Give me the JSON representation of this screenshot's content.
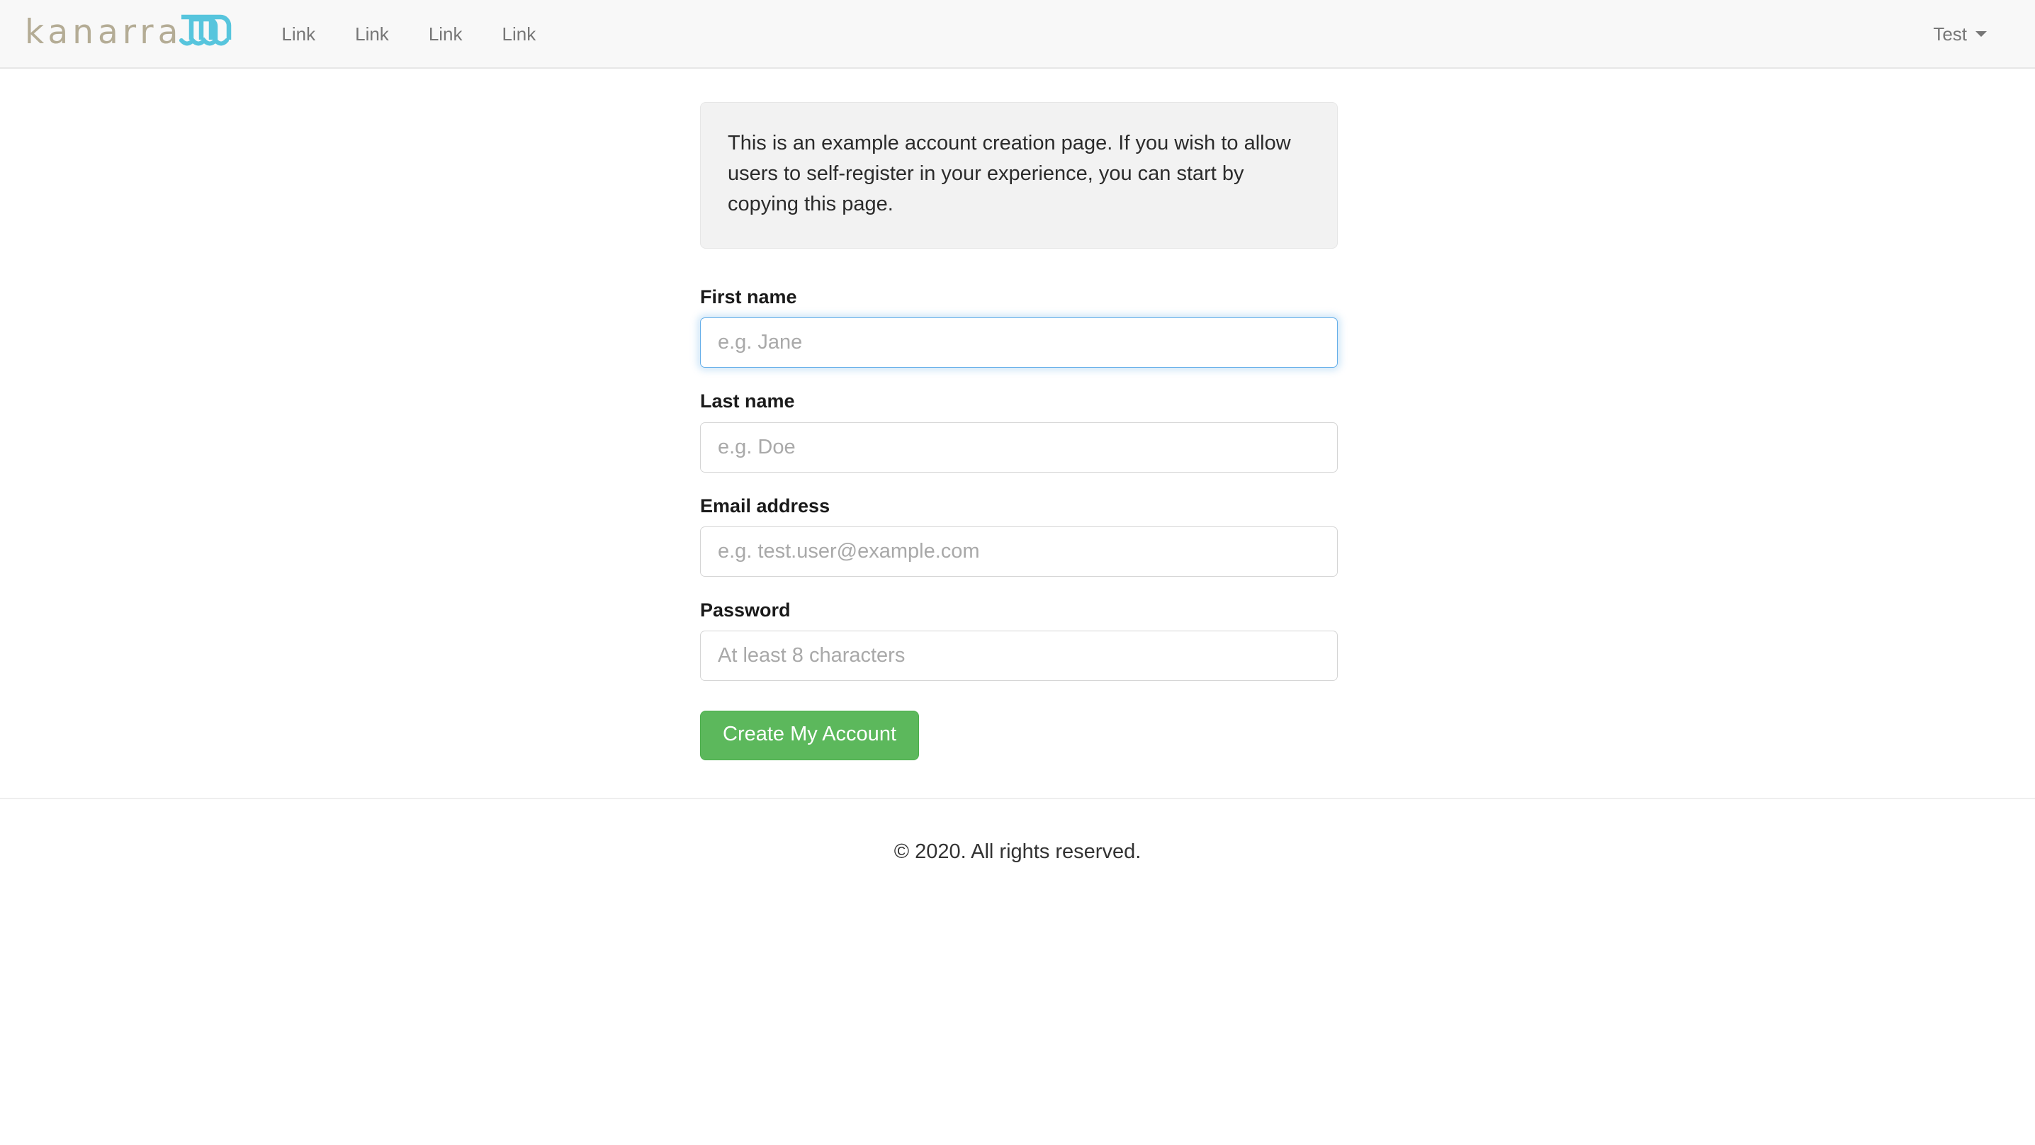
{
  "navbar": {
    "brand": {
      "word": "kanarra",
      "icon": "waterfall-icon",
      "text_color": "#b4ac95",
      "icon_color": "#57c5dd"
    },
    "links": [
      {
        "label": "Link"
      },
      {
        "label": "Link"
      },
      {
        "label": "Link"
      },
      {
        "label": "Link"
      }
    ],
    "user_menu": {
      "label": "Test",
      "caret_icon": "chevron-down-icon"
    }
  },
  "alert": {
    "text": "This is an example account creation page. If you wish to allow users to self-register in your experience, you can start by copying this page."
  },
  "form": {
    "fields": [
      {
        "name": "first-name",
        "label": "First name",
        "placeholder": "e.g. Jane",
        "value": "",
        "focused": true
      },
      {
        "name": "last-name",
        "label": "Last name",
        "placeholder": "e.g. Doe",
        "value": "",
        "focused": false
      },
      {
        "name": "email",
        "label": "Email address",
        "placeholder": "e.g. test.user@example.com",
        "value": "",
        "focused": false
      },
      {
        "name": "password",
        "label": "Password",
        "placeholder": "At least 8 characters",
        "value": "",
        "focused": false
      }
    ],
    "submit_label": "Create My Account",
    "submit_color": "#5cb85c"
  },
  "footer": {
    "copyright": "© 2020. All rights reserved."
  }
}
